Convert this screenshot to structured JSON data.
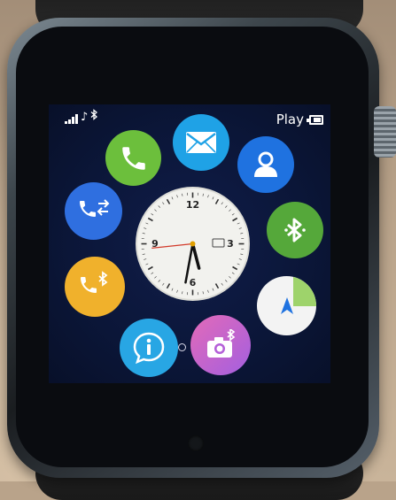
{
  "status_bar": {
    "icons": [
      "signal-bars-icon",
      "music-note-icon",
      "bluetooth-icon",
      "battery-icon"
    ],
    "mode_label": "Play"
  },
  "watch_face": {
    "numerals": [
      "12",
      "3",
      "6",
      "9"
    ],
    "time": {
      "hour": 5,
      "minute": 31,
      "second": 44
    }
  },
  "apps": [
    {
      "name": "phone",
      "icon": "phone-icon",
      "color": "#6cbf3c"
    },
    {
      "name": "messages",
      "icon": "envelope-icon",
      "color": "#1fa2e6"
    },
    {
      "name": "contacts",
      "icon": "person-icon",
      "color": "#1f72e0"
    },
    {
      "name": "call-log",
      "icon": "phone-arrows-icon",
      "color": "#2f6fe0"
    },
    {
      "name": "bluetooth",
      "icon": "bluetooth-icon",
      "color": "#55a83a"
    },
    {
      "name": "bt-dialer",
      "icon": "phone-bluetooth-icon",
      "color": "#f0b12c"
    },
    {
      "name": "compass",
      "icon": "compass-arrow-icon",
      "color": "#f3f3f3"
    },
    {
      "name": "info",
      "icon": "info-icon",
      "color": "#28a6e4"
    },
    {
      "name": "remote-camera",
      "icon": "camera-bluetooth-icon",
      "color": "#c06ad8"
    }
  ]
}
